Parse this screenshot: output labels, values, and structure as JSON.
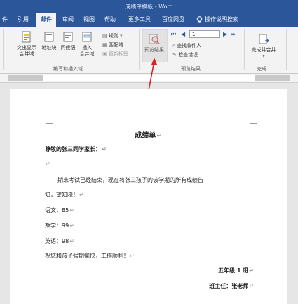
{
  "window": {
    "title": "成绩单模板 - Word"
  },
  "tabs": [
    "件",
    "引用",
    "邮件",
    "审阅",
    "视图",
    "帮助",
    "更多工具",
    "百度网盘",
    "操作说明搜索"
  ],
  "active_tab": "邮件",
  "ribbon": {
    "group1": {
      "highlight_merge": [
        "突出显示",
        "合并域"
      ],
      "address_block": "地址块",
      "greeting_line": "问候语",
      "insert_merge_field": [
        "插入",
        "合并域"
      ],
      "rules": "规则",
      "match_fields": "匹配域",
      "update_labels": "更新标签",
      "label": "编写和插入域"
    },
    "group2": {
      "preview_results": "预览结果",
      "record_number": "1",
      "find_recipient": "查找收件人",
      "check_errors": "检查错误",
      "label": "预览结果"
    },
    "group3": {
      "finish_merge": "完成并合并",
      "label": "完成"
    }
  },
  "document": {
    "title": "成绩单",
    "greeting": "尊敬的张三同学家长：",
    "body": "期末考试已经结束，现在将张三孩子的该学期的所有成绩告",
    "body2": "知，望知晓！",
    "chinese": "语文：85",
    "math": "数学：99",
    "english": "英语：98",
    "wish": "祝您和孩子假期愉快，工作顺利！",
    "class": "五年级 1 班",
    "teacher": "班主任：张老师"
  },
  "colors": {
    "accent": "#2b579a",
    "arrow": "#e02020"
  }
}
